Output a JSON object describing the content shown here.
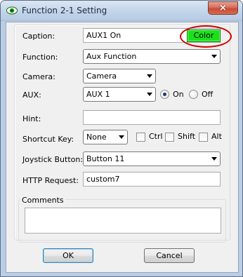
{
  "window": {
    "title": "Function 2-1 Setting",
    "close_glyph": "×"
  },
  "form": {
    "caption": {
      "label": "Caption:",
      "value": "AUX1 On",
      "color_button": "Color",
      "color_button_bg": "#19e219"
    },
    "function": {
      "label": "Function:",
      "selected": "Aux Function"
    },
    "camera": {
      "label": "Camera:",
      "selected": "Camera"
    },
    "aux": {
      "label": "AUX:",
      "selected": "AUX 1",
      "on_label": "On",
      "off_label": "Off",
      "state": "On"
    },
    "hint": {
      "label": "Hint:",
      "value": ""
    },
    "shortcut": {
      "label": "Shortcut Key:",
      "selected": "None",
      "ctrl_label": "Ctrl",
      "shift_label": "Shift",
      "alt_label": "Alt"
    },
    "joystick": {
      "label": "Joystick Button:",
      "selected": "Button 11"
    },
    "http": {
      "label": "HTTP Request:",
      "value": "custom7"
    },
    "comments": {
      "label": "Comments",
      "value": ""
    }
  },
  "buttons": {
    "ok": "OK",
    "cancel": "Cancel"
  },
  "icons": {
    "app": "eye-icon",
    "close": "close-icon"
  },
  "colors": {
    "highlight": "#d00000",
    "title_text": "#1e2a3a"
  }
}
